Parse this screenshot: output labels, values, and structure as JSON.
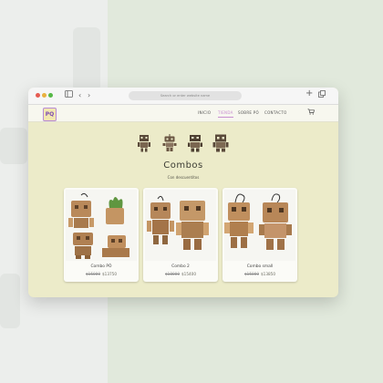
{
  "browser": {
    "address_text": "Search or enter website name"
  },
  "site": {
    "logo_text": "PQ",
    "nav": [
      {
        "label": "INICIO",
        "active": false
      },
      {
        "label": "TIENDA",
        "active": true
      },
      {
        "label": "SOBRE PÓ",
        "active": false
      },
      {
        "label": "CONTACTO",
        "active": false
      }
    ]
  },
  "page": {
    "title": "Combos",
    "subtitle": "Con descuentitos"
  },
  "products": [
    {
      "name": "Combo PÓ",
      "old_price": "$15000",
      "new_price": "$13750"
    },
    {
      "name": "Combo 2",
      "old_price": "$18000",
      "new_price": "$15400"
    },
    {
      "name": "Combo small",
      "old_price": "$15000",
      "new_price": "$13850"
    }
  ],
  "colors": {
    "site_background": "#ecebc9",
    "accent_nav": "#c98fd1",
    "wood": "#b9895a"
  }
}
